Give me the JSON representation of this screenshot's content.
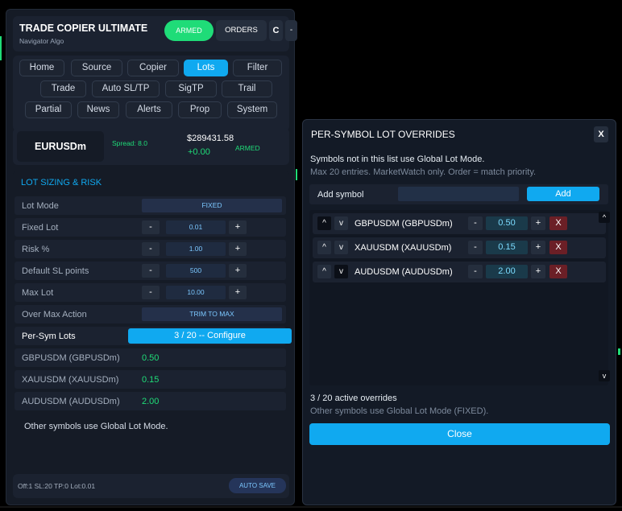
{
  "header": {
    "title": "TRADE COPIER ULTIMATE",
    "subtitle": "Navigator Algo",
    "armed_label": "ARMED",
    "orders_label": "ORDERS",
    "c_label": "C",
    "minimize_label": "-"
  },
  "tabs": {
    "row1": [
      "Home",
      "Source",
      "Copier",
      "Lots",
      "Filter"
    ],
    "row2": [
      "Trade",
      "Auto SL/TP",
      "SigTP",
      "Trail"
    ],
    "row3": [
      "Partial",
      "News",
      "Alerts",
      "Prop",
      "System"
    ],
    "active": "Lots"
  },
  "symbol_bar": {
    "symbol": "EURUSDm",
    "spread": "Spread: 8.0",
    "balance": "$289431.58",
    "pnl": "+0.00",
    "status": "ARMED"
  },
  "lot_section": {
    "title": "LOT SIZING & RISK",
    "lot_mode_label": "Lot Mode",
    "lot_mode_value": "FIXED",
    "fixed_lot_label": "Fixed Lot",
    "fixed_lot_value": "0.01",
    "risk_label": "Risk %",
    "risk_value": "1.00",
    "sl_label": "Default SL points",
    "sl_value": "500",
    "max_lot_label": "Max Lot",
    "max_lot_value": "10.00",
    "over_max_label": "Over Max Action",
    "over_max_value": "TRIM TO MAX",
    "per_sym_label": "Per-Sym Lots",
    "per_sym_button": "3 / 20 -- Configure",
    "symbols": [
      {
        "name": "GBPUSDM (GBPUSDm)",
        "lot": "0.50"
      },
      {
        "name": "XAUUSDM (XAUUSDm)",
        "lot": "0.15"
      },
      {
        "name": "AUDUSDM (AUDUSDm)",
        "lot": "2.00"
      }
    ],
    "footnote": "Other symbols use Global Lot Mode.",
    "minus": "-",
    "plus": "+"
  },
  "footer": {
    "status": "Off:1  SL:20  TP:0  Lot:0.01",
    "autosave": "AUTO SAVE"
  },
  "dialog": {
    "title": "PER-SYMBOL LOT OVERRIDES",
    "close_x": "X",
    "line1": "Symbols not in this list use Global Lot Mode.",
    "line2": "Max 20 entries. MarketWatch only. Order = match priority.",
    "add_symbol_label": "Add symbol",
    "add_symbol_value": "",
    "add_button": "Add",
    "up": "^",
    "down": "v",
    "remove": "X",
    "overrides": [
      {
        "name": "GBPUSDM (GBPUSDm)",
        "lot": "0.50"
      },
      {
        "name": "XAUUSDM (XAUUSDm)",
        "lot": "0.15"
      },
      {
        "name": "AUDUSDM (AUDUSDm)",
        "lot": "2.00"
      }
    ],
    "active_count": "3 / 20 active overrides",
    "active_note": "Other symbols use Global Lot Mode (FIXED).",
    "close_button": "Close"
  },
  "colors": {
    "accent": "#10a9f0",
    "green": "#1fdc78",
    "danger": "#6b1f26",
    "panel": "#151b26"
  }
}
